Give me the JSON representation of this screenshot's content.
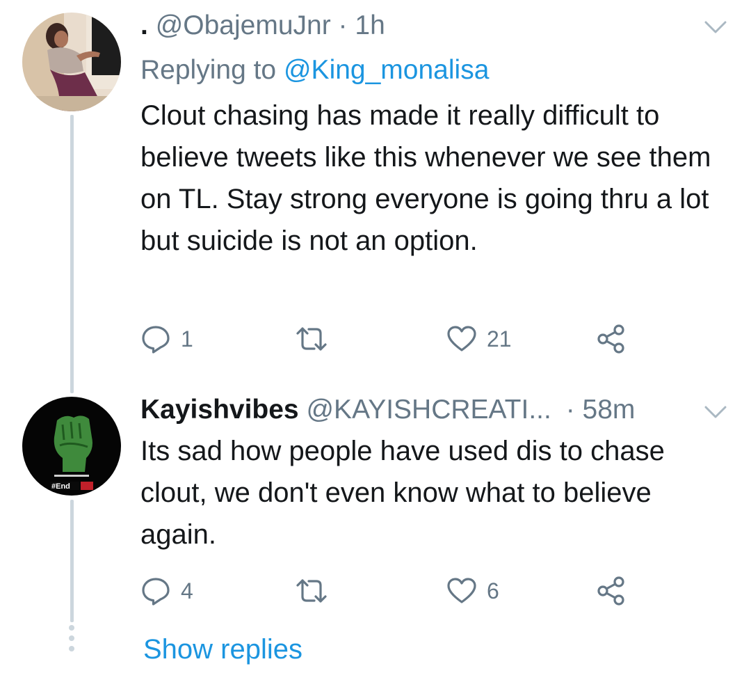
{
  "tweets": [
    {
      "display_name": ".",
      "handle": "@ObajemuJnr",
      "separator": "·",
      "time": "1h",
      "replying_label": "Replying to",
      "replying_to": "@King_monalisa",
      "text": "Clout chasing has made it really difficult to believe tweets like this whenever we see them on TL. Stay strong everyone is going thru a lot but suicide is not an option.",
      "replies": "1",
      "retweets": "",
      "likes": "21"
    },
    {
      "display_name": "Kayishvibes",
      "handle": "@KAYISHCREATI...",
      "separator": "·",
      "time": "58m",
      "avatar_text": "#End",
      "text": "Its sad how people have used dis to chase clout, we don't even know what to believe again.",
      "replies": "4",
      "retweets": "",
      "likes": "6"
    }
  ],
  "show_replies_label": "Show replies",
  "icons": {
    "reply": "reply-icon",
    "retweet": "retweet-icon",
    "like": "heart-icon",
    "share": "share-icon",
    "caret": "chevron-down-icon"
  },
  "colors": {
    "link": "#1b95e0",
    "secondary": "#657786",
    "thread_line": "#ccd6dd",
    "text": "#14171a"
  }
}
